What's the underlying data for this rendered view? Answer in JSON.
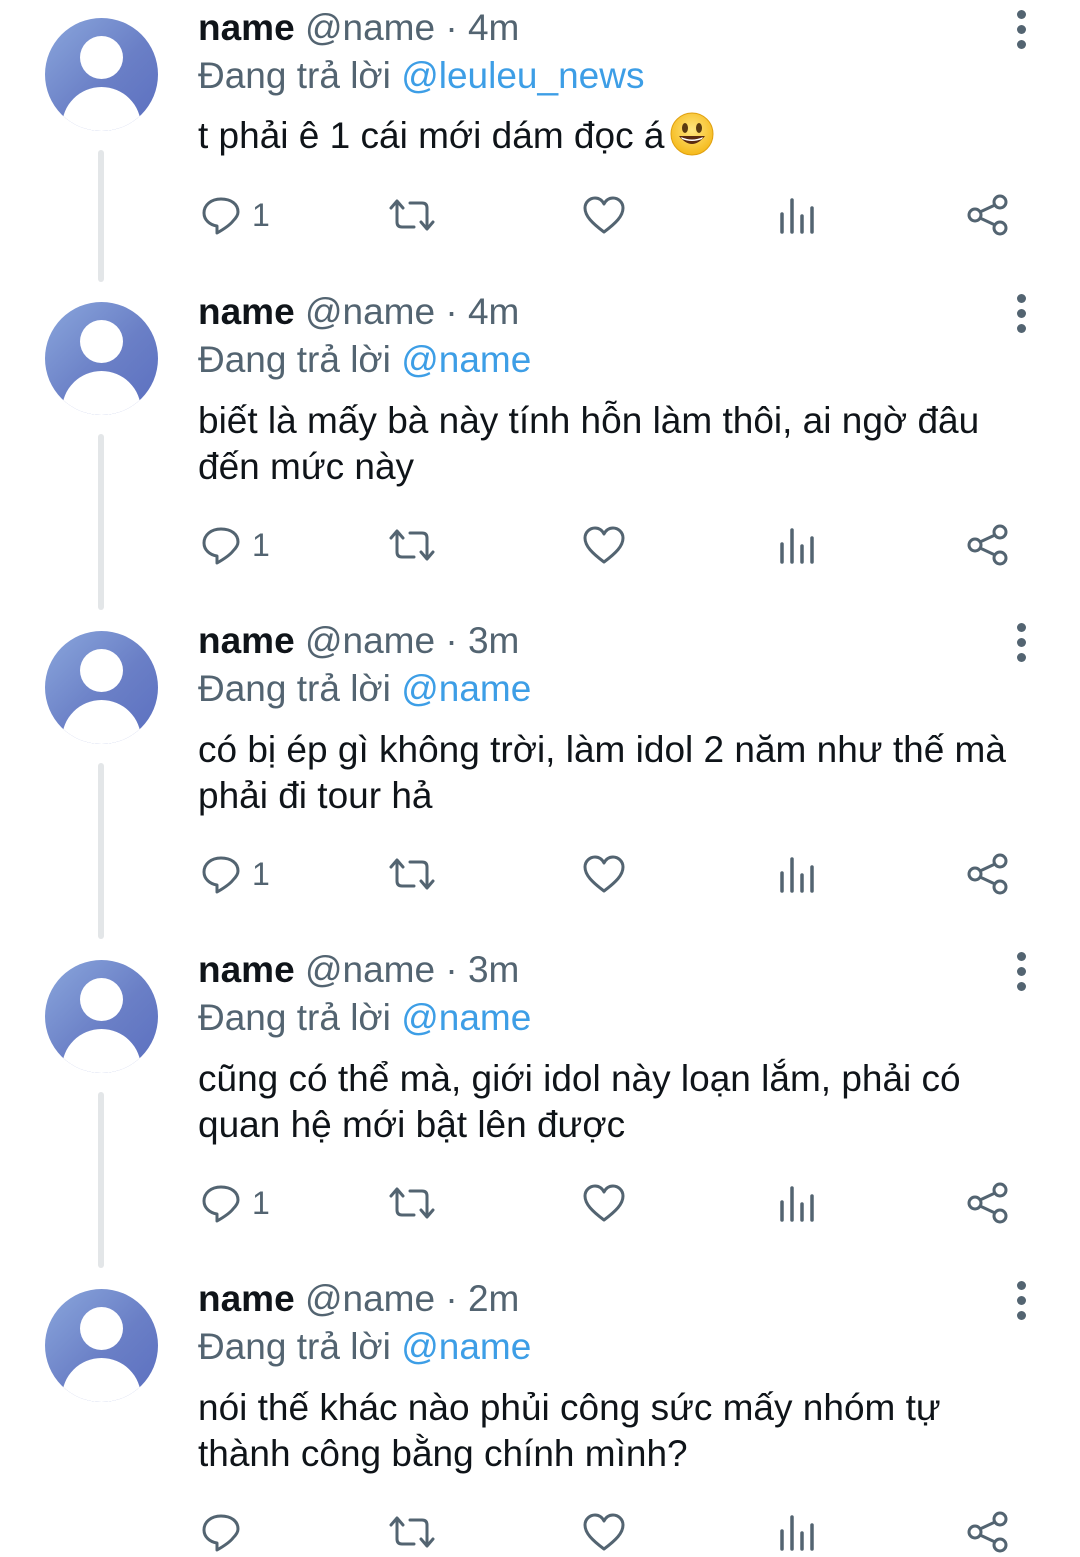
{
  "tweets": [
    {
      "name": "name",
      "handle": "@name",
      "separator": "·",
      "time": "4m",
      "reply_prefix": "Đang trả lời",
      "reply_to": "@leuleu_news",
      "text": "t phải ê 1 cái mới dám đọc á",
      "emoji": "grinning-face-emoji",
      "reply_count": "1"
    },
    {
      "name": "name",
      "handle": "@name",
      "separator": "·",
      "time": "4m",
      "reply_prefix": "Đang trả lời",
      "reply_to": "@name",
      "text": "biết là mấy bà này tính hỗn làm thôi, ai ngờ đâu đến mức này",
      "reply_count": "1"
    },
    {
      "name": "name",
      "handle": "@name",
      "separator": "·",
      "time": "3m",
      "reply_prefix": "Đang trả lời",
      "reply_to": "@name",
      "text": "có bị ép gì không trời, làm idol 2 năm như thế mà phải đi tour hả",
      "reply_count": "1"
    },
    {
      "name": "name",
      "handle": "@name",
      "separator": "·",
      "time": "3m",
      "reply_prefix": "Đang trả lời",
      "reply_to": "@name",
      "text": "cũng có thể mà, giới idol này loạn lắm, phải có quan hệ mới bật lên được",
      "reply_count": "1"
    },
    {
      "name": "name",
      "handle": "@name",
      "separator": "·",
      "time": "2m",
      "reply_prefix": "Đang trả lời",
      "reply_to": "@name",
      "text": "nói thế khác nào phủi công sức mấy nhóm tự thành công bằng chính mình?",
      "reply_count": ""
    }
  ],
  "icons": {
    "reply": "reply-icon",
    "retweet": "retweet-icon",
    "like": "heart-icon",
    "views": "views-icon",
    "share": "share-icon",
    "more": "more-options-icon"
  },
  "colors": {
    "text": "#0f1419",
    "secondary": "#536471",
    "mention": "#3d9ee6",
    "thread_line": "#e3e6e8",
    "avatar": "#6a7fc6"
  }
}
